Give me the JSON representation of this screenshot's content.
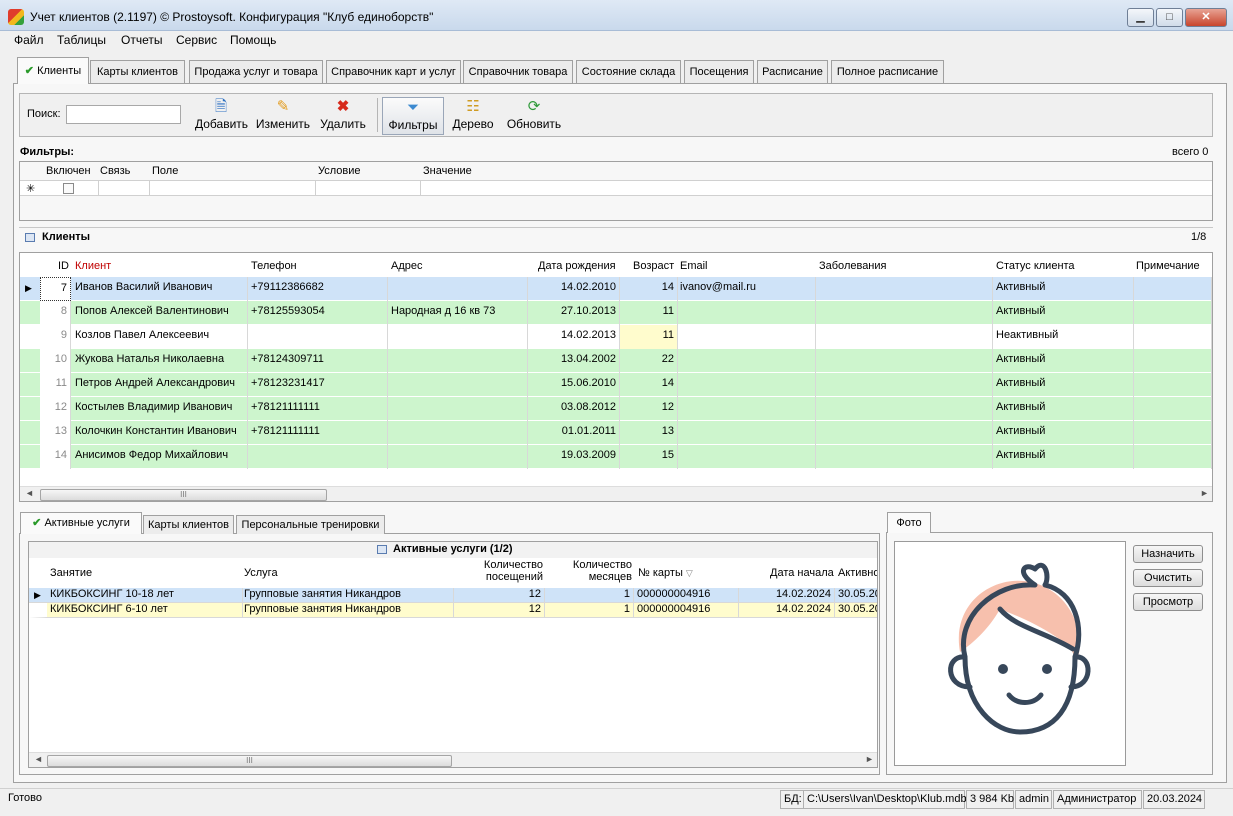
{
  "window": {
    "title": "Учет клиентов (2.1197) © Prostoysoft. Конфигурация \"Клуб единоборств\"",
    "minimize": "▁",
    "maximize": "□",
    "close": "✕"
  },
  "menu": [
    "Файл",
    "Таблицы",
    "Отчеты",
    "Сервис",
    "Помощь"
  ],
  "tabs": [
    "Клиенты",
    "Карты клиентов",
    "Продажа услуг и товара",
    "Справочник карт и услуг",
    "Справочник товара",
    "Состояние склада",
    "Посещения",
    "Расписание",
    "Полное расписание"
  ],
  "toolbar": {
    "search_label": "Поиск:",
    "search_value": "",
    "add": "Добавить",
    "edit": "Изменить",
    "delete": "Удалить",
    "filters": "Фильтры",
    "tree": "Дерево",
    "refresh": "Обновить"
  },
  "filters": {
    "title": "Фильтры:",
    "total": "всего 0",
    "columns": [
      "Включен",
      "Связь",
      "Поле",
      "Условие",
      "Значение"
    ],
    "new_row_marker": "✳"
  },
  "clients": {
    "title": "Клиенты",
    "count": "1/8",
    "columns": [
      "ID",
      "Клиент",
      "Телефон",
      "Адрес",
      "Дата рождения",
      "Возраст",
      "Email",
      "Заболевания",
      "Статус клиента",
      "Примечание"
    ],
    "rows": [
      {
        "id": "7",
        "name": "Иванов Василий Иванович",
        "phone": "+79112386682",
        "address": "",
        "birth": "14.02.2010",
        "age": "14",
        "email": "ivanov@mail.ru",
        "disease": "",
        "status": "Активный",
        "note": ""
      },
      {
        "id": "8",
        "name": "Попов Алексей Валентинович",
        "phone": "+78125593054",
        "address": "Народная д 16 кв 73",
        "birth": "27.10.2013",
        "age": "11",
        "email": "",
        "disease": "",
        "status": "Активный",
        "note": ""
      },
      {
        "id": "9",
        "name": "Козлов Павел Алексеевич",
        "phone": "",
        "address": "",
        "birth": "14.02.2013",
        "age": "11",
        "email": "",
        "disease": "",
        "status": "Неактивный",
        "note": ""
      },
      {
        "id": "10",
        "name": "Жукова Наталья Николаевна",
        "phone": "+78124309711",
        "address": "",
        "birth": "13.04.2002",
        "age": "22",
        "email": "",
        "disease": "",
        "status": "Активный",
        "note": ""
      },
      {
        "id": "11",
        "name": "Петров Андрей Александрович",
        "phone": "+78123231417",
        "address": "",
        "birth": "15.06.2010",
        "age": "14",
        "email": "",
        "disease": "",
        "status": "Активный",
        "note": ""
      },
      {
        "id": "12",
        "name": "Костылев Владимир Иванович",
        "phone": "+78121111111",
        "address": "",
        "birth": "03.08.2012",
        "age": "12",
        "email": "",
        "disease": "",
        "status": "Активный",
        "note": ""
      },
      {
        "id": "13",
        "name": "Колочкин Константин Иванович",
        "phone": "+78121111111",
        "address": "",
        "birth": "01.01.2011",
        "age": "13",
        "email": "",
        "disease": "",
        "status": "Активный",
        "note": ""
      },
      {
        "id": "14",
        "name": "Анисимов Федор Михайлович",
        "phone": "",
        "address": "",
        "birth": "19.03.2009",
        "age": "15",
        "email": "",
        "disease": "",
        "status": "Активный",
        "note": ""
      }
    ]
  },
  "bottom_tabs": [
    "Активные услуги",
    "Карты клиентов",
    "Персональные тренировки"
  ],
  "services": {
    "title": "Активные услуги (1/2)",
    "columns": [
      "Занятие",
      "Услуга",
      "Количество посещений",
      "Количество месяцев",
      "№ карты",
      "Дата начала",
      "Активно"
    ],
    "rows": [
      {
        "lesson": "КИКБОКСИНГ 10-18 лет",
        "service": "Групповые занятия Никандров",
        "visits": "12",
        "months": "1",
        "card": "000000004916",
        "start": "14.02.2024",
        "active": "30.05.20"
      },
      {
        "lesson": "КИКБОКСИНГ 6-10 лет",
        "service": "Групповые занятия Никандров",
        "visits": "12",
        "months": "1",
        "card": "000000004916",
        "start": "14.02.2024",
        "active": "30.05.20"
      }
    ]
  },
  "photo": {
    "tab": "Фото",
    "assign": "Назначить",
    "clear": "Очистить",
    "view": "Просмотр"
  },
  "status": {
    "ready": "Готово",
    "db_label": "БД:",
    "db_path": "C:\\Users\\Ivan\\Desktop\\Klub.mdb",
    "size": "3 984 Kb",
    "user": "admin",
    "role": "Администратор",
    "date": "20.03.2024"
  },
  "colors": {
    "green_row": "#cdf5cd",
    "selected_row": "#cfe3f8",
    "yellow_row": "#fffccd",
    "client_header": "#c00000"
  }
}
